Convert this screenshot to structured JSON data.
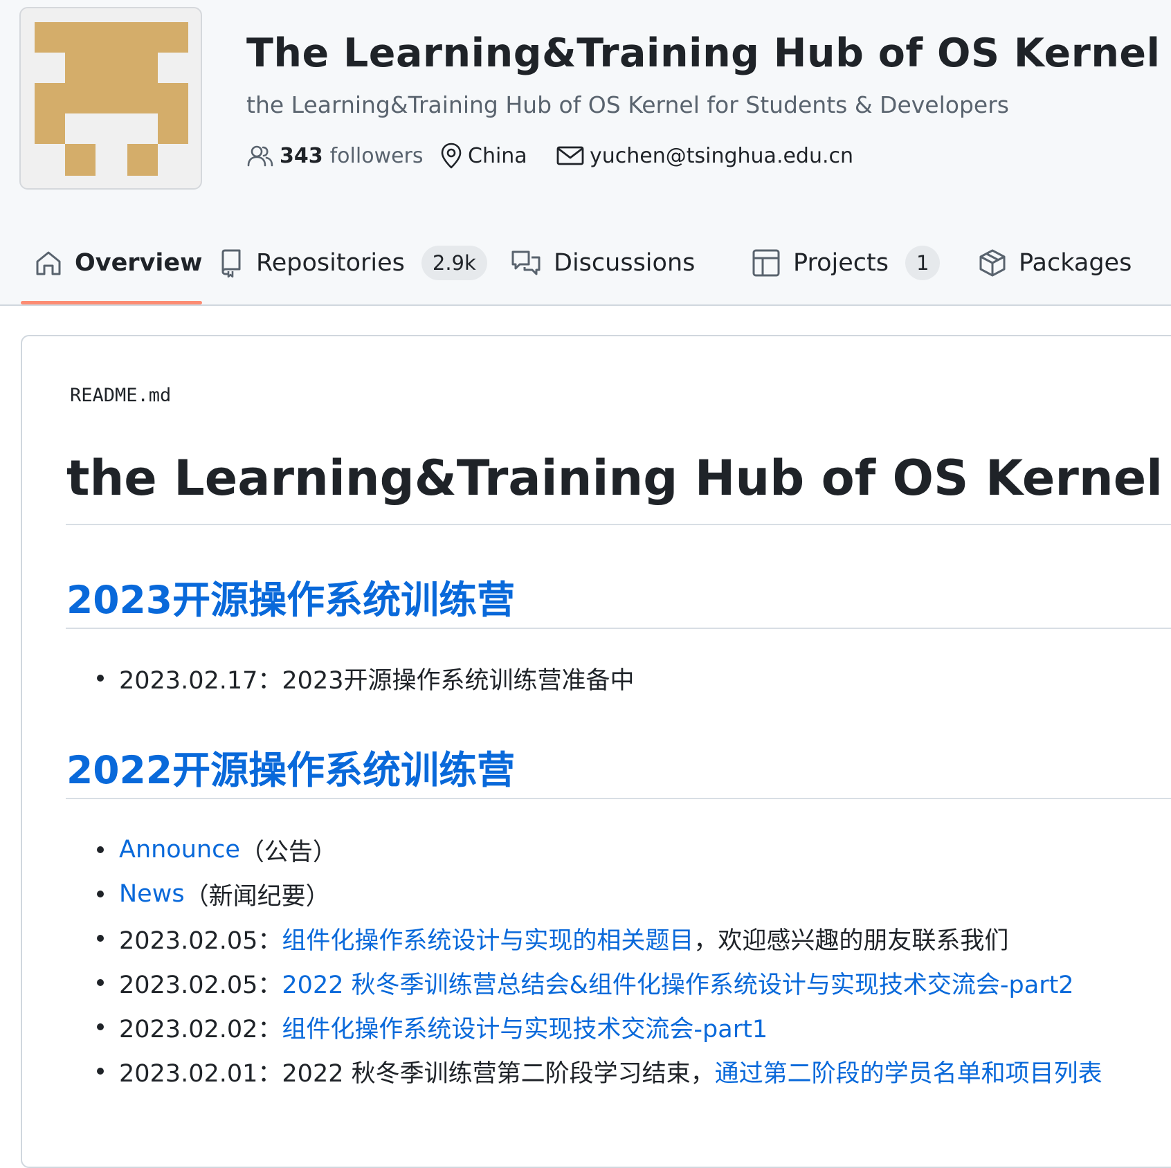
{
  "org": {
    "title": "The Learning&Training Hub of OS Kernel",
    "description": "the Learning&Training Hub of OS Kernel for Students & Developers",
    "followers_count": "343",
    "followers_label": "followers",
    "location": "China",
    "email": "yuchen@tsinghua.edu.cn"
  },
  "tabs": [
    {
      "label": "Overview",
      "icon": "home-icon",
      "selected": true
    },
    {
      "label": "Repositories",
      "icon": "repo-icon",
      "count": "2.9k"
    },
    {
      "label": "Discussions",
      "icon": "comment-discussion-icon"
    },
    {
      "label": "Projects",
      "icon": "table-icon",
      "count": "1"
    },
    {
      "label": "Packages",
      "icon": "package-icon"
    }
  ],
  "readme": {
    "filename": "README.md",
    "h1": "the Learning&Training Hub of OS Kernel",
    "section_2023": {
      "heading": "2023开源操作系统训练营",
      "items": [
        {
          "date": "2023.02.17：",
          "text": "2023开源操作系统训练营准备中"
        }
      ]
    },
    "section_2022": {
      "heading": "2022开源操作系统训练营",
      "items": [
        {
          "link": "Announce",
          "text": "（公告）"
        },
        {
          "link": "News",
          "text": "（新闻纪要）"
        },
        {
          "date": "2023.02.05：",
          "link": "组件化操作系统设计与实现的相关题目",
          "text": "，欢迎感兴趣的朋友联系我们"
        },
        {
          "date": "2023.02.05：",
          "link": "2022 秋冬季训练营总结会&组件化操作系统设计与实现技术交流会-part2"
        },
        {
          "date": "2023.02.02：",
          "link": "组件化操作系统设计与实现技术交流会-part1"
        },
        {
          "date": "2023.02.01：",
          "text": "2022 秋冬季训练营第二阶段学习结束，",
          "link": "通过第二阶段的学员名单和项目列表"
        }
      ]
    }
  },
  "colors": {
    "link": "#0969da",
    "avatar_tan": "#d4ad6a",
    "tab_underline": "#fd8c73"
  }
}
